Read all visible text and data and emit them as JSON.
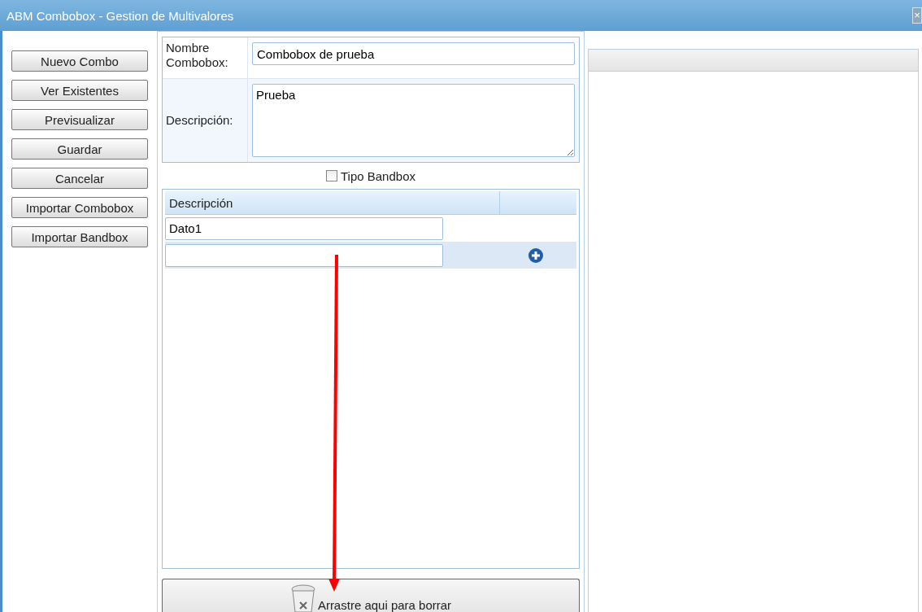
{
  "window": {
    "title": "ABM Combobox - Gestion de Multivalores",
    "close": "×"
  },
  "actions": [
    "Nuevo Combo",
    "Ver Existentes",
    "Previsualizar",
    "Guardar",
    "Cancelar",
    "Importar Combobox",
    "Importar Bandbox"
  ],
  "form": {
    "name_label": "Nombre Combobox:",
    "name_value": "Combobox de prueba",
    "description_label": "Descripción:",
    "description_value": "Prueba"
  },
  "bandbox": {
    "label": "Tipo Bandbox",
    "checked": false
  },
  "grid": {
    "columns": [
      "Descripción"
    ],
    "rows": [
      {
        "value": "Dato1",
        "kind": "item"
      },
      {
        "value": "",
        "kind": "new"
      }
    ]
  },
  "drop_target": {
    "label": "Arrastre aqui para borrar"
  }
}
